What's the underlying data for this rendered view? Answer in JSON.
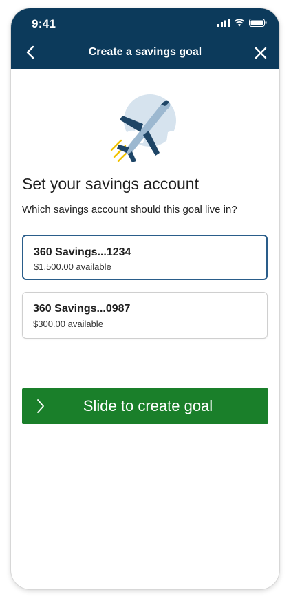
{
  "status_bar": {
    "time": "9:41",
    "icons": [
      "signal-icon",
      "wifi-icon",
      "battery-icon"
    ]
  },
  "header": {
    "title": "Create a savings goal",
    "back_icon": "chevron-left-icon",
    "close_icon": "close-icon",
    "background": "#0c3a5b"
  },
  "illustration": {
    "icon": "airplane-icon"
  },
  "main": {
    "heading": "Set your savings account",
    "subheading": "Which savings account should this goal live in?"
  },
  "accounts": [
    {
      "name": "360 Savings...1234",
      "balance": "$1,500.00 available",
      "selected": true
    },
    {
      "name": "360 Savings...0987",
      "balance": "$300.00 available",
      "selected": false
    }
  ],
  "slider": {
    "label": "Slide to create goal",
    "color": "#1a7f2a",
    "handle_icon": "chevron-right-icon"
  }
}
